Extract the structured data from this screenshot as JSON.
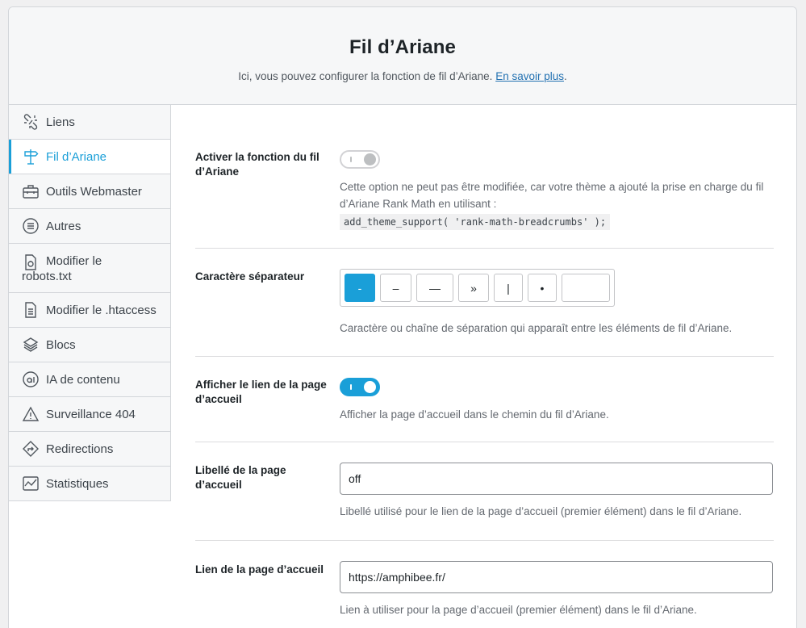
{
  "header": {
    "title": "Fil d’Ariane",
    "description": "Ici, vous pouvez configurer la fonction de fil d’Ariane.",
    "learn_more": "En savoir plus",
    "period": "."
  },
  "sidebar": {
    "items": [
      {
        "label": "Liens",
        "icon": "link-broken-icon"
      },
      {
        "label": "Fil d’Ariane",
        "icon": "signpost-icon",
        "active": true
      },
      {
        "label": "Outils Webmaster",
        "icon": "toolbox-icon"
      },
      {
        "label": "Autres",
        "icon": "list-circle-icon"
      },
      {
        "label_line1": "Modifier le",
        "label_line2": "robots.txt",
        "icon": "robot-file-icon"
      },
      {
        "label": "Modifier le .htaccess",
        "icon": "file-text-icon"
      },
      {
        "label": "Blocs",
        "icon": "blocks-icon"
      },
      {
        "label": "IA de contenu",
        "icon": "ai-icon"
      },
      {
        "label": "Surveillance 404",
        "icon": "warning-icon"
      },
      {
        "label": "Redirections",
        "icon": "redirect-icon"
      },
      {
        "label": "Statistiques",
        "icon": "chart-icon"
      }
    ]
  },
  "settings": {
    "enable": {
      "label": "Activer la fonction du fil d’Ariane",
      "state": "off",
      "help": "Cette option ne peut pas être modifiée, car votre thème a ajouté la prise en charge du fil d’Ariane Rank Math en utilisant :",
      "code": "add_theme_support( 'rank-math-breadcrumbs' );"
    },
    "separator": {
      "label": "Caractère séparateur",
      "options": [
        "-",
        "–",
        "—",
        "»",
        "|",
        "•",
        ""
      ],
      "selected": "-",
      "help": "Caractère ou chaîne de séparation qui apparaît entre les éléments de fil d’Ariane."
    },
    "home_link": {
      "label": "Afficher le lien de la page d’accueil",
      "state": "on",
      "help": "Afficher la page d’accueil dans le chemin du fil d’Ariane."
    },
    "home_label": {
      "label": "Libellé de la page d’accueil",
      "value": "off",
      "help": "Libellé utilisé pour le lien de la page d’accueil (premier élément) dans le fil d’Ariane."
    },
    "home_url": {
      "label": "Lien de la page d’accueil",
      "value": "https://amphibee.fr/",
      "help": "Lien à utiliser pour la page d’accueil (premier élément) dans le fil d’Ariane."
    }
  },
  "colors": {
    "accent": "#1a9fd8",
    "border": "#d3d6da",
    "link": "#2271b1"
  }
}
